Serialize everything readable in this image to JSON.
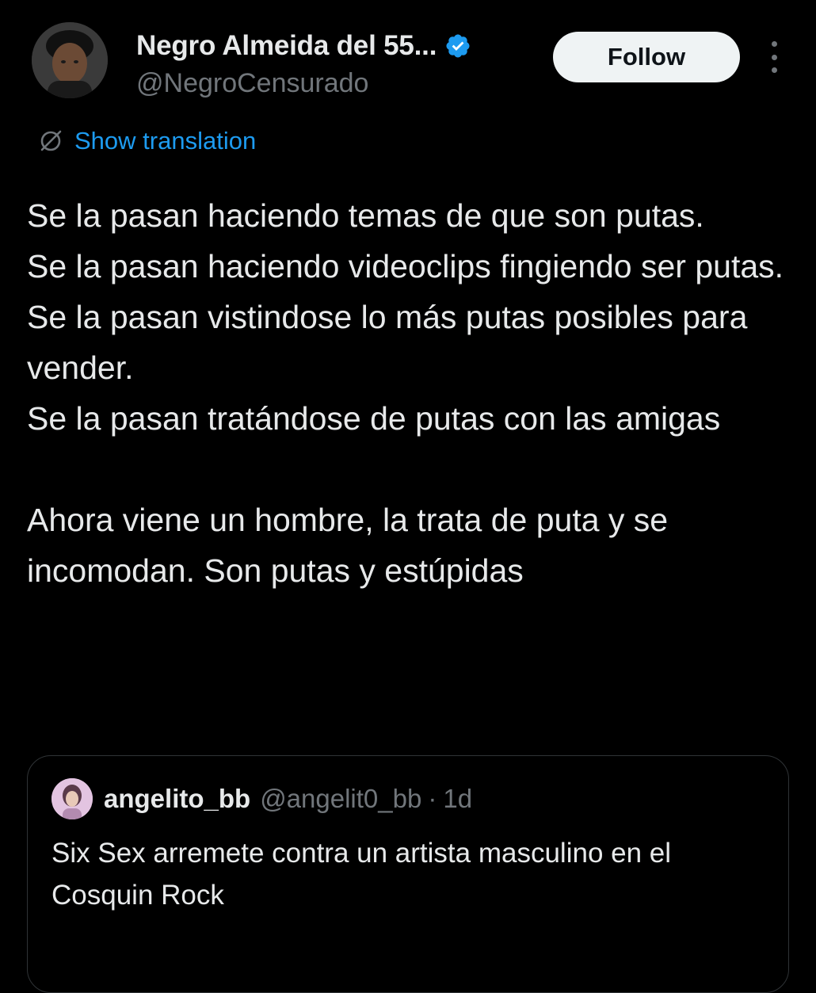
{
  "author": {
    "display_name": "Negro Almeida del 55...",
    "handle": "@NegroCensurado",
    "verified_icon": "verified-badge-icon",
    "avatar_icon": "avatar-photo"
  },
  "follow_button": {
    "label": "Follow"
  },
  "more_menu": {
    "icon": "more-vertical-icon"
  },
  "translation": {
    "icon": "globe-icon",
    "label": "Show translation"
  },
  "tweet": {
    "lines": [
      "Se la pasan haciendo temas de que son putas.",
      "Se la pasan haciendo videoclips fingiendo ser putas.",
      "Se la pasan vistindose lo más putas posibles para vender.",
      "Se la pasan tratándose de putas con las amigas",
      "Ahora viene un hombre, la trata de puta y se incomodan. Son putas y estúpidas"
    ]
  },
  "quoted_tweet": {
    "display_name": "angelito_bb",
    "handle": "@angelit0_bb",
    "separator": "·",
    "time": "1d",
    "text": "Six Sex arremete contra un artista masculino en el Cosquin Rock"
  },
  "colors": {
    "background": "#000000",
    "primary_text": "#e7e9ea",
    "secondary_text": "#71767b",
    "link": "#1d9bf0",
    "follow_bg": "#eff3f4",
    "border": "#2f3336"
  }
}
